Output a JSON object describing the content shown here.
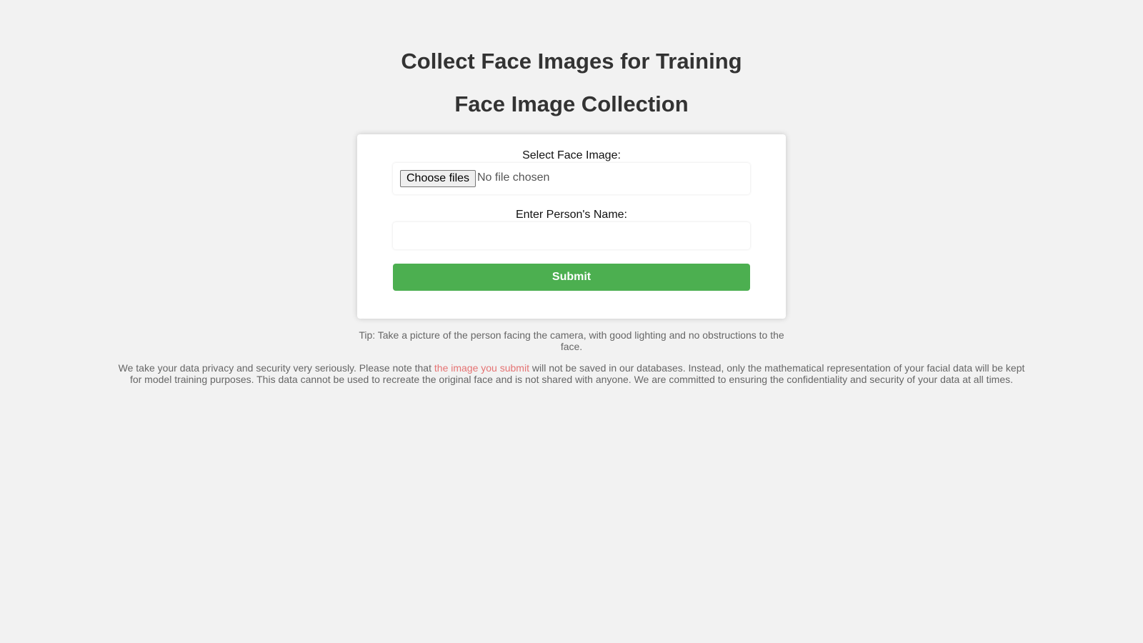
{
  "page": {
    "main_title": "Collect Face Images for Training",
    "sub_title": "Face Image Collection"
  },
  "form": {
    "file_label": "Select Face Image:",
    "file_button_label": "Choose files",
    "file_status": "No file chosen",
    "name_label": "Enter Person's Name:",
    "name_value": "",
    "name_placeholder": "",
    "submit_label": "Submit"
  },
  "notes": {
    "tip": "Tip: Take a picture of the person facing the camera, with good lighting and no obstructions to the face.",
    "privacy_before": "We take your data privacy and security very seriously. Please note that ",
    "privacy_highlight": "the image you submit",
    "privacy_after": " will not be saved in our databases. Instead, only the mathematical representation of your facial data will be kept for model training purposes. This data cannot be used to recreate the original face and is not shared with anyone. We are committed to ensuring the confidentiality and security of your data at all times."
  },
  "colors": {
    "background": "#f2f2f2",
    "submit_button": "#4caf50",
    "highlight_text": "#e57373"
  }
}
